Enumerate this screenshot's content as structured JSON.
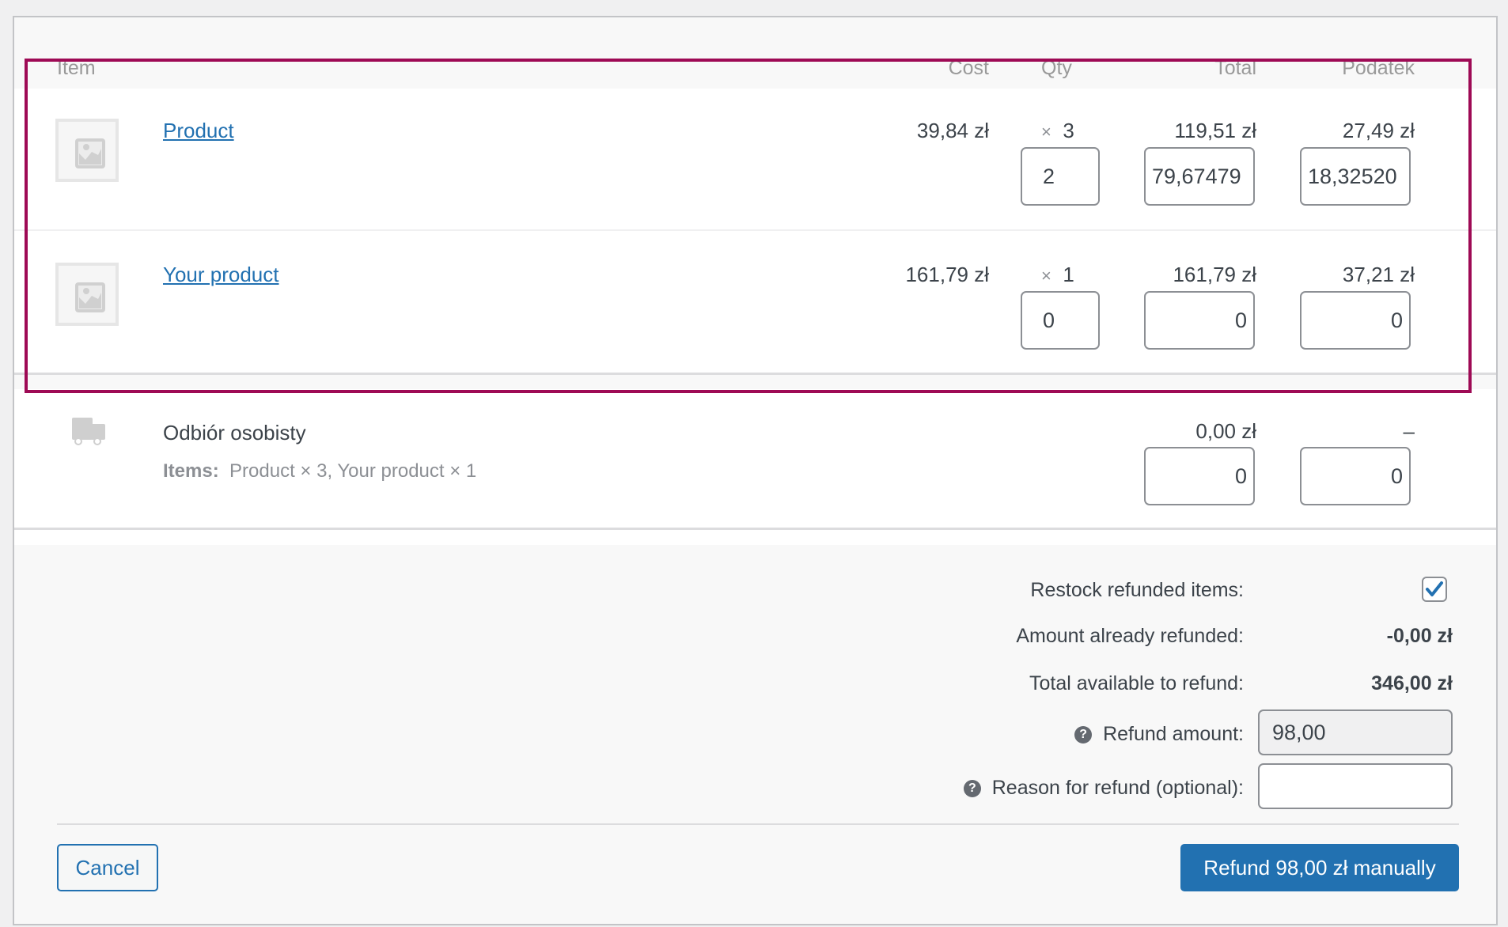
{
  "table": {
    "headers": {
      "item": "Item",
      "cost": "Cost",
      "qty": "Qty",
      "total": "Total",
      "tax": "Podatek"
    },
    "rows": [
      {
        "name": "Product",
        "cost": "39,84 zł",
        "qty_multiplier": "×",
        "qty": "3",
        "total": "119,51 zł",
        "tax": "27,49 zł",
        "refund_qty": "2",
        "refund_total": "79,67479",
        "refund_tax": "18,32520"
      },
      {
        "name": "Your product",
        "cost": "161,79 zł",
        "qty_multiplier": "×",
        "qty": "1",
        "total": "161,79 zł",
        "tax": "37,21 zł",
        "refund_qty": "0",
        "refund_total": "0",
        "refund_tax": "0"
      }
    ],
    "shipping": {
      "name": "Odbiór osobisty",
      "items_label": "Items:",
      "items_value": "Product × 3, Your product × 1",
      "total": "0,00 zł",
      "tax": "–",
      "refund_total": "0",
      "refund_tax": "0"
    }
  },
  "refund": {
    "restock_label": "Restock refunded items:",
    "restock_checked": true,
    "already_refunded_label": "Amount already refunded:",
    "already_refunded_value": "-0,00 zł",
    "available_label": "Total available to refund:",
    "available_value": "346,00 zł",
    "amount_label": "Refund amount:",
    "amount_value": "98,00",
    "reason_label": "Reason for refund (optional):",
    "reason_value": "",
    "help_glyph": "?"
  },
  "actions": {
    "cancel_label": "Cancel",
    "refund_label": "Refund 98,00 zł manually"
  },
  "colors": {
    "accent": "#2271b1",
    "highlight": "#9e0a55"
  }
}
